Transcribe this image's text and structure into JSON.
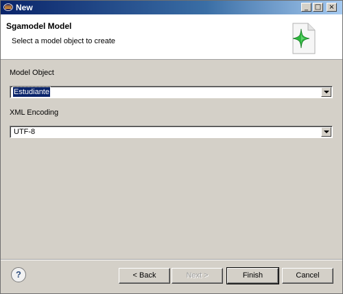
{
  "window": {
    "title": "New",
    "icon": "eclipse-icon",
    "controls": {
      "minimize": "_",
      "maximize": "□",
      "close": "×"
    }
  },
  "header": {
    "title": "Sgamodel Model",
    "description": "Select a model object to create",
    "icon": "new-model-wizard-icon"
  },
  "form": {
    "model_object_label": "Model Object",
    "model_object_value": "Estudiante",
    "xml_encoding_label": "XML Encoding",
    "xml_encoding_value": "UTF-8"
  },
  "footer": {
    "help_label": "?",
    "back_label": "< Back",
    "next_label": "Next >",
    "finish_label": "Finish",
    "cancel_label": "Cancel"
  },
  "colors": {
    "dialog_bg": "#d4d0c8",
    "titlebar_start": "#0a246a",
    "titlebar_end": "#a6caf0",
    "icon_green": "#2db83d"
  }
}
